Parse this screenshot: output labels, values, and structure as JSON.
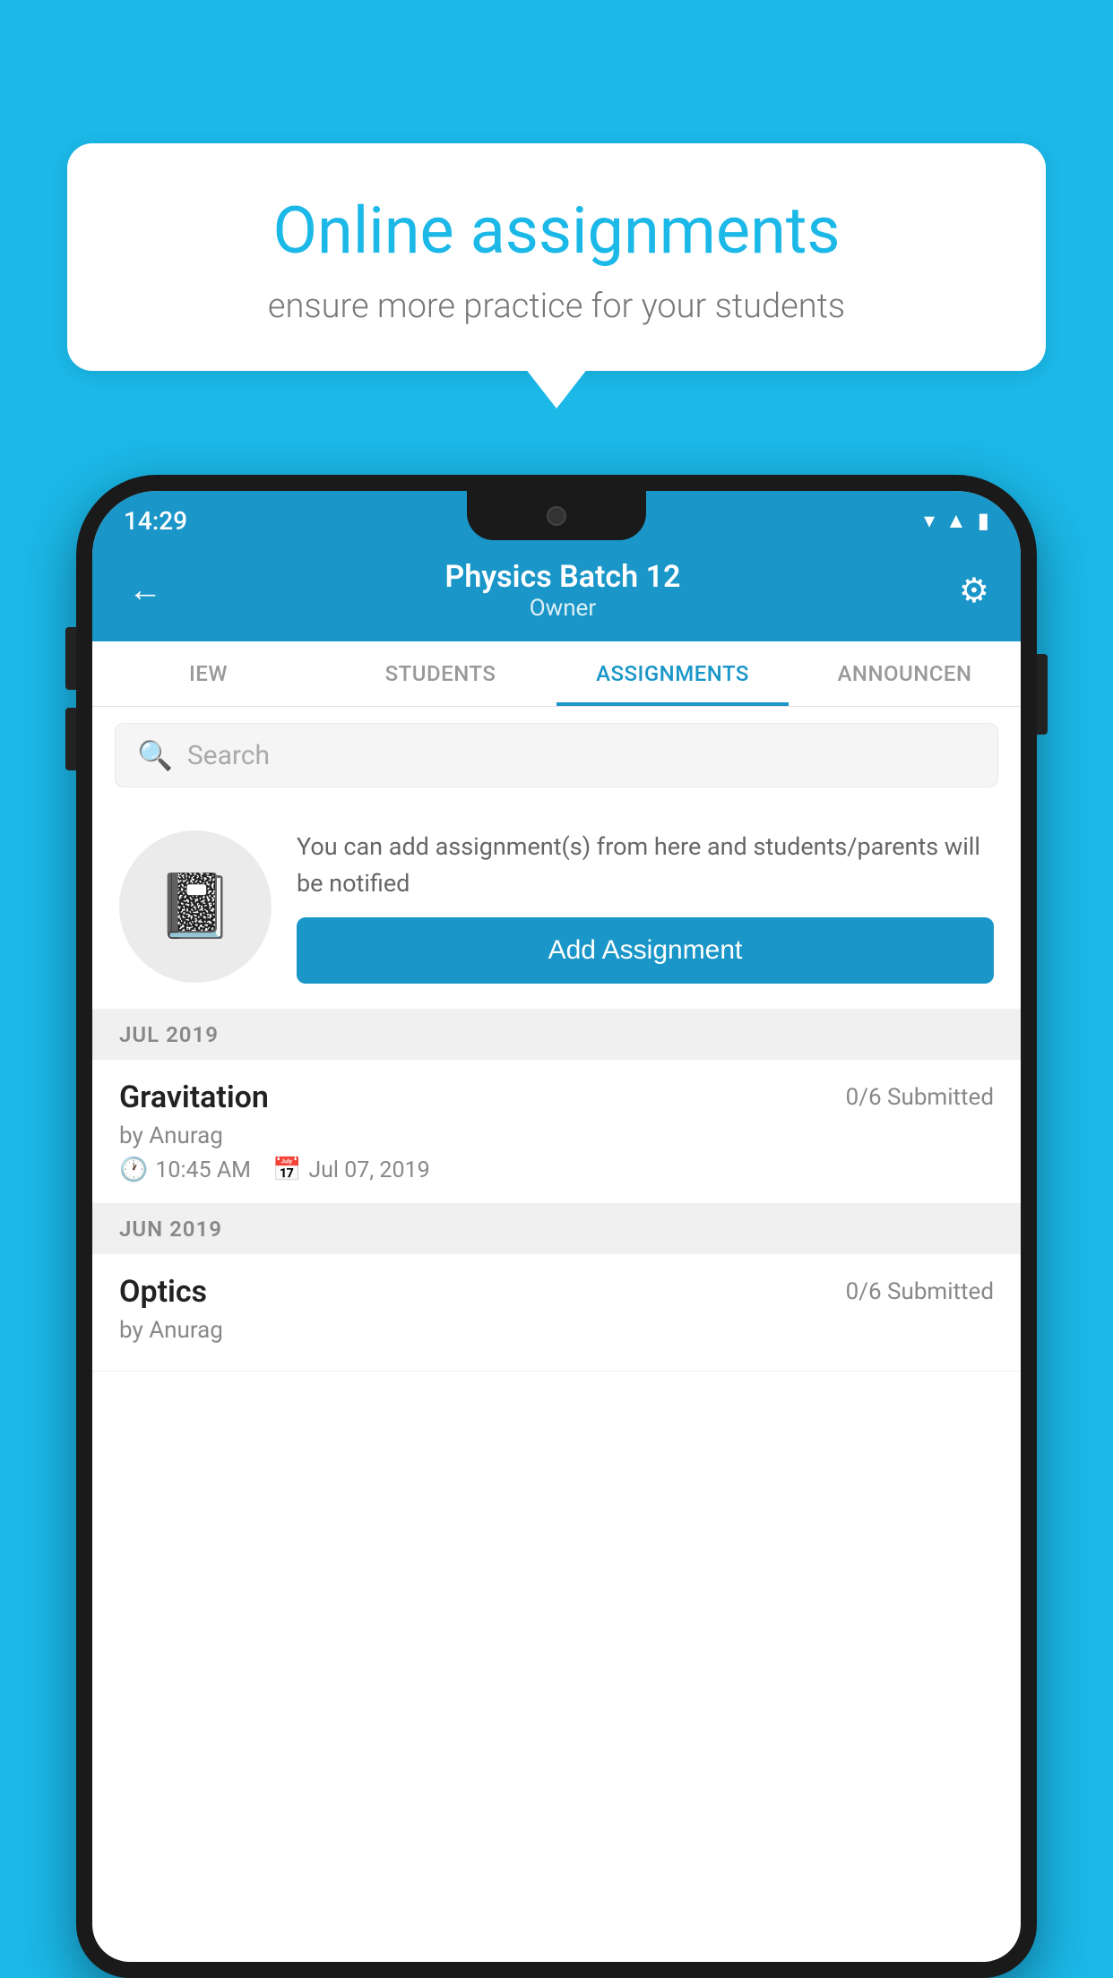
{
  "background_color": "#1BB8E8",
  "speech_bubble": {
    "title": "Online assignments",
    "subtitle": "ensure more practice for your students"
  },
  "status_bar": {
    "time": "14:29",
    "icons": [
      "wifi",
      "signal",
      "battery"
    ]
  },
  "header": {
    "title": "Physics Batch 12",
    "subtitle": "Owner",
    "back_label": "←",
    "gear_label": "⚙"
  },
  "tabs": [
    {
      "label": "IEW",
      "active": false
    },
    {
      "label": "STUDENTS",
      "active": false
    },
    {
      "label": "ASSIGNMENTS",
      "active": true
    },
    {
      "label": "ANNOUNCEN",
      "active": false
    }
  ],
  "search": {
    "placeholder": "Search"
  },
  "promo": {
    "text": "You can add assignment(s) from here and students/parents will be notified",
    "button_label": "Add Assignment"
  },
  "sections": [
    {
      "header": "JUL 2019",
      "assignments": [
        {
          "title": "Gravitation",
          "submitted": "0/6 Submitted",
          "author": "by Anurag",
          "time": "10:45 AM",
          "date": "Jul 07, 2019"
        }
      ]
    },
    {
      "header": "JUN 2019",
      "assignments": [
        {
          "title": "Optics",
          "submitted": "0/6 Submitted",
          "author": "by Anurag",
          "time": "",
          "date": ""
        }
      ]
    }
  ]
}
